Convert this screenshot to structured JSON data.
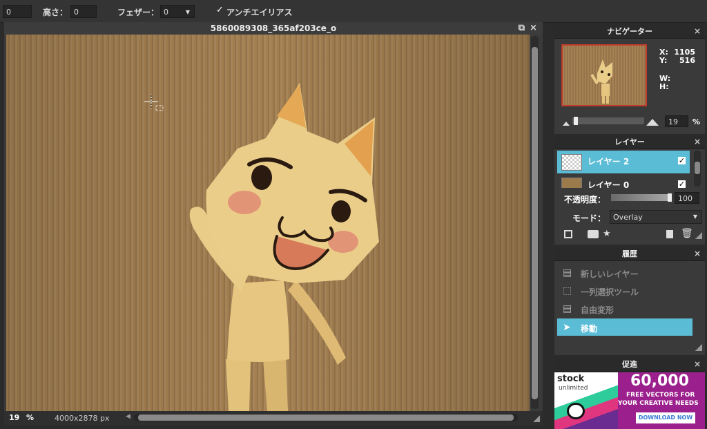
{
  "toolbar": {
    "width_value": "0",
    "height_label": "高さ：",
    "height_value": "0",
    "feather_label": "フェザー：",
    "feather_value": "0",
    "antialias_label": "アンチエイリアス",
    "antialias_check": "✓"
  },
  "canvas": {
    "title": "5860089308_365af203ce_o",
    "zoom_value": "19",
    "zoom_unit": "%",
    "dimensions": "4000x2878 px"
  },
  "navigator": {
    "title": "ナビゲーター",
    "x_label": "X:",
    "x_value": "1105",
    "y_label": "Y:",
    "y_value": "516",
    "w_label": "W:",
    "h_label": "H:",
    "zoom_value": "19",
    "zoom_unit": "%"
  },
  "layers": {
    "title": "レイヤー",
    "items": [
      {
        "name": "レイヤー 2",
        "check": "✓"
      },
      {
        "name": "レイヤー 0",
        "check": "✓"
      }
    ],
    "opacity_label": "不透明度：",
    "opacity_value": "100",
    "opacity_fraction": 1.0,
    "mode_label": "モード：",
    "mode_value": "Overlay"
  },
  "history": {
    "title": "履歴",
    "items": [
      {
        "label": "新しいレイヤー"
      },
      {
        "label": "一列選択ツール"
      },
      {
        "label": "自由変形"
      },
      {
        "label": "移動"
      }
    ]
  },
  "promo": {
    "title": "促進",
    "brand_stock": "stock",
    "brand_unlimited": "unlimited",
    "headline": "60,000",
    "line1": "FREE VECTORS FOR",
    "line2": "YOUR CREATIVE NEEDS",
    "cta": "DOWNLOAD NOW"
  },
  "common": {
    "close": "×"
  },
  "colors": {
    "selected": "#5bbcd6",
    "promo_purple": "#9b1f8c",
    "cta_blue": "#3a7bd5",
    "nav_border": "#c0392b"
  }
}
